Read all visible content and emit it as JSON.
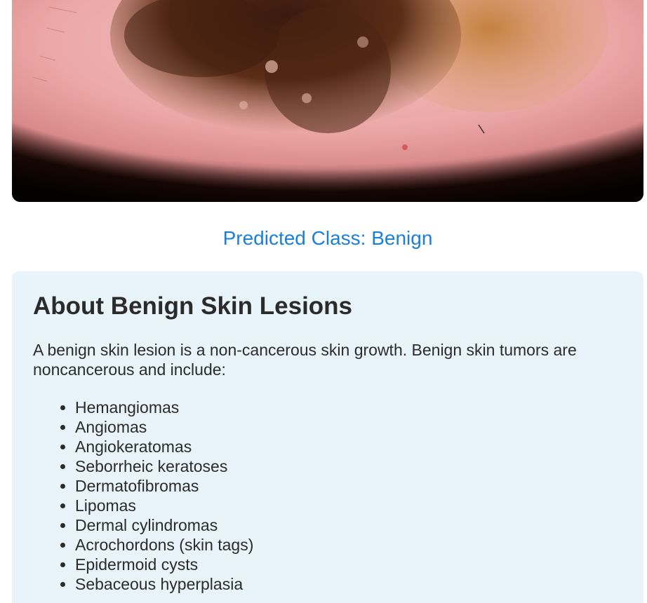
{
  "prediction": {
    "label": "Predicted Class: Benign"
  },
  "info": {
    "title": "About Benign Skin Lesions",
    "description": "A benign skin lesion is a non-cancerous skin growth. Benign skin tumors are noncancerous and include:",
    "items": [
      "Hemangiomas",
      "Angiomas",
      "Angiokeratomas",
      "Seborrheic keratoses",
      "Dermatofibromas",
      "Lipomas",
      "Dermal cylindromas",
      "Acrochordons (skin tags)",
      "Epidermoid cysts",
      "Sebaceous hyperplasia"
    ]
  },
  "colors": {
    "prediction_text": "#1a7fd9",
    "card_background": "#e8f4fa",
    "body_text": "#2b2b2b"
  }
}
